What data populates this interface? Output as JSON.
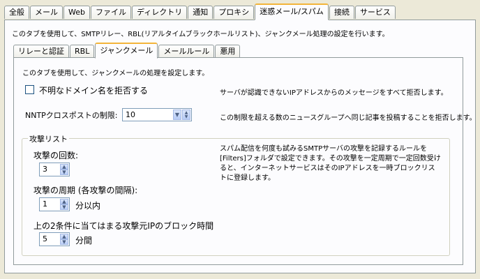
{
  "tabs": [
    "全般",
    "メール",
    "Web",
    "ファイル",
    "ディレクトリ",
    "通知",
    "プロキシ",
    "迷惑メール/スパム",
    "接続",
    "サービス"
  ],
  "description": "このタブを使用して、SMTPリレー、RBL(リアルタイムブラックホールリスト)、ジャンクメール処理の設定を行います。",
  "subtabs": [
    "リレーと認証",
    "RBL",
    "ジャンクメール",
    "メールルール",
    "悪用"
  ],
  "junk": {
    "description": "このタブを使用して、ジャンクメールの処理を設定します。",
    "reject_unknown_label": "不明なドメイン名を拒否する",
    "reject_unknown_desc": "サーバが認識できないIPアドレスからのメッセージをすべて拒否します。",
    "nntp_label": "NNTPクロスポストの制限:",
    "nntp_value": "10",
    "nntp_desc": "この制限を超える数のニュースグループへ同じ記事を投稿することを拒否します。",
    "attack_group": {
      "title": "攻撃リスト",
      "count_label": "攻撃の回数:",
      "count_value": "3",
      "period_label": "攻撃の周期 (各攻撃の間隔):",
      "period_value": "1",
      "period_unit": "分以内",
      "block_label": "上の2条件に当てはまる攻撃元IPのブロック時間",
      "block_value": "5",
      "block_unit": "分間",
      "desc": "スパム配信を何度も試みるSMTPサーバの攻撃を記録するルールを[Filters]フォルダで設定できます。その攻撃を一定周期で一定回数受けると、インターネットサービスはそのIPアドレスを一時ブロックリストに登録します。"
    }
  }
}
